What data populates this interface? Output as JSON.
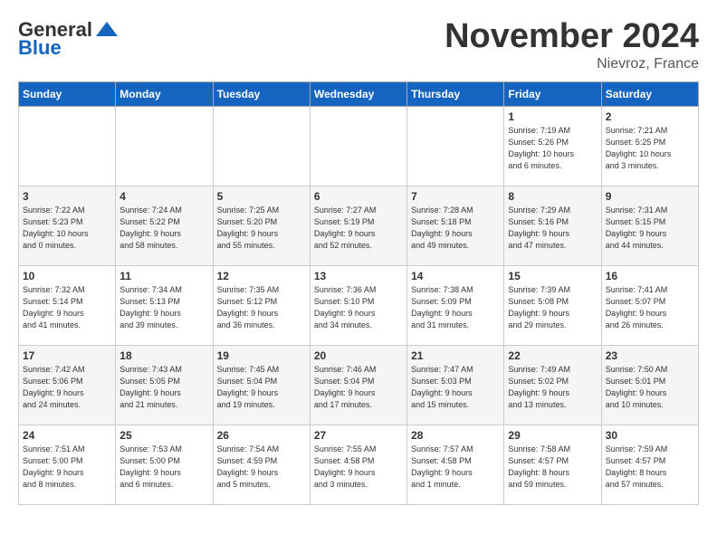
{
  "header": {
    "logo": {
      "general": "General",
      "blue": "Blue",
      "tagline": "GeneralBlue"
    },
    "title": "November 2024",
    "location": "Nievroz, France"
  },
  "days_of_week": [
    "Sunday",
    "Monday",
    "Tuesday",
    "Wednesday",
    "Thursday",
    "Friday",
    "Saturday"
  ],
  "weeks": [
    [
      {
        "day": "",
        "info": ""
      },
      {
        "day": "",
        "info": ""
      },
      {
        "day": "",
        "info": ""
      },
      {
        "day": "",
        "info": ""
      },
      {
        "day": "",
        "info": ""
      },
      {
        "day": "1",
        "info": "Sunrise: 7:19 AM\nSunset: 5:26 PM\nDaylight: 10 hours\nand 6 minutes."
      },
      {
        "day": "2",
        "info": "Sunrise: 7:21 AM\nSunset: 5:25 PM\nDaylight: 10 hours\nand 3 minutes."
      }
    ],
    [
      {
        "day": "3",
        "info": "Sunrise: 7:22 AM\nSunset: 5:23 PM\nDaylight: 10 hours\nand 0 minutes."
      },
      {
        "day": "4",
        "info": "Sunrise: 7:24 AM\nSunset: 5:22 PM\nDaylight: 9 hours\nand 58 minutes."
      },
      {
        "day": "5",
        "info": "Sunrise: 7:25 AM\nSunset: 5:20 PM\nDaylight: 9 hours\nand 55 minutes."
      },
      {
        "day": "6",
        "info": "Sunrise: 7:27 AM\nSunset: 5:19 PM\nDaylight: 9 hours\nand 52 minutes."
      },
      {
        "day": "7",
        "info": "Sunrise: 7:28 AM\nSunset: 5:18 PM\nDaylight: 9 hours\nand 49 minutes."
      },
      {
        "day": "8",
        "info": "Sunrise: 7:29 AM\nSunset: 5:16 PM\nDaylight: 9 hours\nand 47 minutes."
      },
      {
        "day": "9",
        "info": "Sunrise: 7:31 AM\nSunset: 5:15 PM\nDaylight: 9 hours\nand 44 minutes."
      }
    ],
    [
      {
        "day": "10",
        "info": "Sunrise: 7:32 AM\nSunset: 5:14 PM\nDaylight: 9 hours\nand 41 minutes."
      },
      {
        "day": "11",
        "info": "Sunrise: 7:34 AM\nSunset: 5:13 PM\nDaylight: 9 hours\nand 39 minutes."
      },
      {
        "day": "12",
        "info": "Sunrise: 7:35 AM\nSunset: 5:12 PM\nDaylight: 9 hours\nand 36 minutes."
      },
      {
        "day": "13",
        "info": "Sunrise: 7:36 AM\nSunset: 5:10 PM\nDaylight: 9 hours\nand 34 minutes."
      },
      {
        "day": "14",
        "info": "Sunrise: 7:38 AM\nSunset: 5:09 PM\nDaylight: 9 hours\nand 31 minutes."
      },
      {
        "day": "15",
        "info": "Sunrise: 7:39 AM\nSunset: 5:08 PM\nDaylight: 9 hours\nand 29 minutes."
      },
      {
        "day": "16",
        "info": "Sunrise: 7:41 AM\nSunset: 5:07 PM\nDaylight: 9 hours\nand 26 minutes."
      }
    ],
    [
      {
        "day": "17",
        "info": "Sunrise: 7:42 AM\nSunset: 5:06 PM\nDaylight: 9 hours\nand 24 minutes."
      },
      {
        "day": "18",
        "info": "Sunrise: 7:43 AM\nSunset: 5:05 PM\nDaylight: 9 hours\nand 21 minutes."
      },
      {
        "day": "19",
        "info": "Sunrise: 7:45 AM\nSunset: 5:04 PM\nDaylight: 9 hours\nand 19 minutes."
      },
      {
        "day": "20",
        "info": "Sunrise: 7:46 AM\nSunset: 5:04 PM\nDaylight: 9 hours\nand 17 minutes."
      },
      {
        "day": "21",
        "info": "Sunrise: 7:47 AM\nSunset: 5:03 PM\nDaylight: 9 hours\nand 15 minutes."
      },
      {
        "day": "22",
        "info": "Sunrise: 7:49 AM\nSunset: 5:02 PM\nDaylight: 9 hours\nand 13 minutes."
      },
      {
        "day": "23",
        "info": "Sunrise: 7:50 AM\nSunset: 5:01 PM\nDaylight: 9 hours\nand 10 minutes."
      }
    ],
    [
      {
        "day": "24",
        "info": "Sunrise: 7:51 AM\nSunset: 5:00 PM\nDaylight: 9 hours\nand 8 minutes."
      },
      {
        "day": "25",
        "info": "Sunrise: 7:53 AM\nSunset: 5:00 PM\nDaylight: 9 hours\nand 6 minutes."
      },
      {
        "day": "26",
        "info": "Sunrise: 7:54 AM\nSunset: 4:59 PM\nDaylight: 9 hours\nand 5 minutes."
      },
      {
        "day": "27",
        "info": "Sunrise: 7:55 AM\nSunset: 4:58 PM\nDaylight: 9 hours\nand 3 minutes."
      },
      {
        "day": "28",
        "info": "Sunrise: 7:57 AM\nSunset: 4:58 PM\nDaylight: 9 hours\nand 1 minute."
      },
      {
        "day": "29",
        "info": "Sunrise: 7:58 AM\nSunset: 4:57 PM\nDaylight: 8 hours\nand 59 minutes."
      },
      {
        "day": "30",
        "info": "Sunrise: 7:59 AM\nSunset: 4:57 PM\nDaylight: 8 hours\nand 57 minutes."
      }
    ]
  ]
}
